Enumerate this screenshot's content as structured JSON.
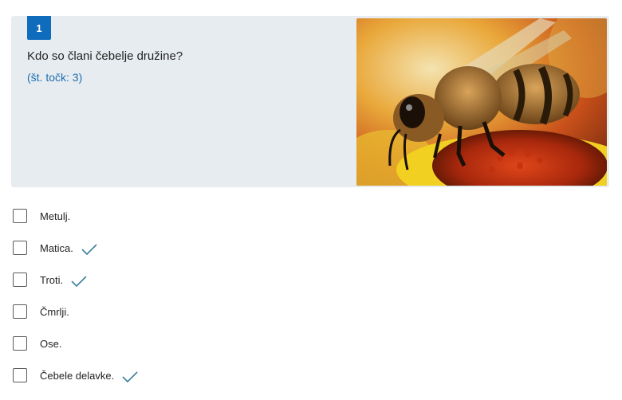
{
  "question": {
    "number": "1",
    "text": "Kdo so člani čebelje družine?",
    "points": "(št. točk: 3)",
    "image_icon": "bee-on-flower-photo"
  },
  "options": [
    {
      "label": "Metulj.",
      "correct": false
    },
    {
      "label": "Matica.",
      "correct": true
    },
    {
      "label": "Troti.",
      "correct": true
    },
    {
      "label": "Čmrlji.",
      "correct": false
    },
    {
      "label": "Ose.",
      "correct": false
    },
    {
      "label": "Čebele delavke.",
      "correct": true
    }
  ],
  "colors": {
    "accent": "#0f6cbd",
    "card_bg": "#e6ecf0",
    "check": "#3c7f9c"
  }
}
